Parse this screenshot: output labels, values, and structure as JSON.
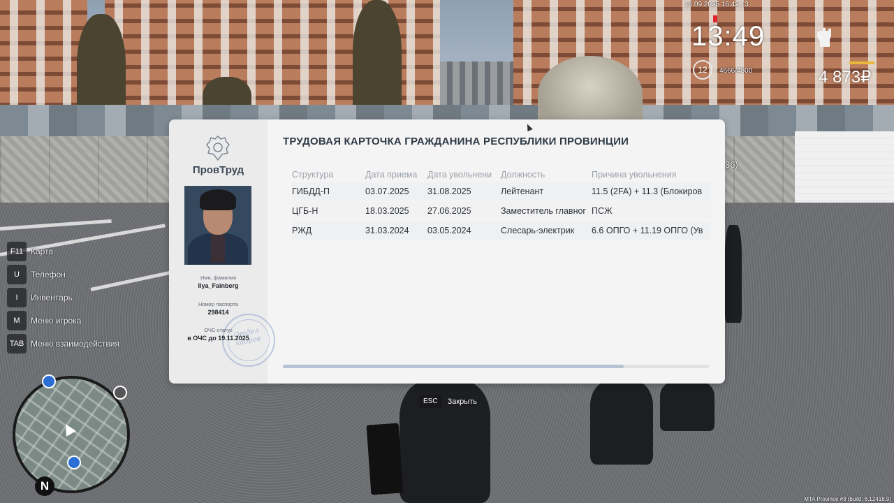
{
  "hud": {
    "datetime": "16.09.2025 16:42:13",
    "time": "13:49",
    "level": "12",
    "xp": "4666/4800",
    "money": "4 873₽",
    "nearby_tag": "36)"
  },
  "keybinds": [
    {
      "key": "F11",
      "label": "Карта"
    },
    {
      "key": "U",
      "label": "Телефон"
    },
    {
      "key": "I",
      "label": "Инвентарь"
    },
    {
      "key": "M",
      "label": "Меню игрока"
    },
    {
      "key": "TAB",
      "label": "Меню взаимодействия"
    }
  ],
  "minimap": {
    "north": "N"
  },
  "card": {
    "org": "ПровТруд",
    "title": "ТРУДОВАЯ КАРТОЧКА ГРАЖДАНИНА РЕСПУБЛИКИ ПРОВИНЦИИ",
    "name_label": "Имя, фамилия",
    "name": "Ilya_Fainberg",
    "passport_label": "Номер паспорта",
    "passport": "298414",
    "status_label": "ОЧС-статус",
    "status": "в ОЧС до 19.11.2025",
    "stamp_line1": "Отдел",
    "stamp_line2": "кадров",
    "columns": [
      "Структура",
      "Дата приема",
      "Дата увольнени",
      "Должность",
      "Причина увольнения"
    ],
    "rows": [
      [
        "ГИБДД-П",
        "03.07.2025",
        "31.08.2025",
        "Лейтенант",
        "11.5 (2FA) + 11.3 (Блокиров"
      ],
      [
        "ЦГБ-Н",
        "18.03.2025",
        "27.06.2025",
        "Заместитель главног",
        "ПСЖ"
      ],
      [
        "РЖД",
        "31.03.2024",
        "03.05.2024",
        "Слесарь-электрик",
        "6.6 ОПГО + 11.19 ОПГО (Ув"
      ]
    ],
    "scroll_fraction": 0.8
  },
  "close_hint": {
    "key": "ESC",
    "label": "Закрыть"
  },
  "build": "MTA Province #3 (build: 6.12418.9)"
}
